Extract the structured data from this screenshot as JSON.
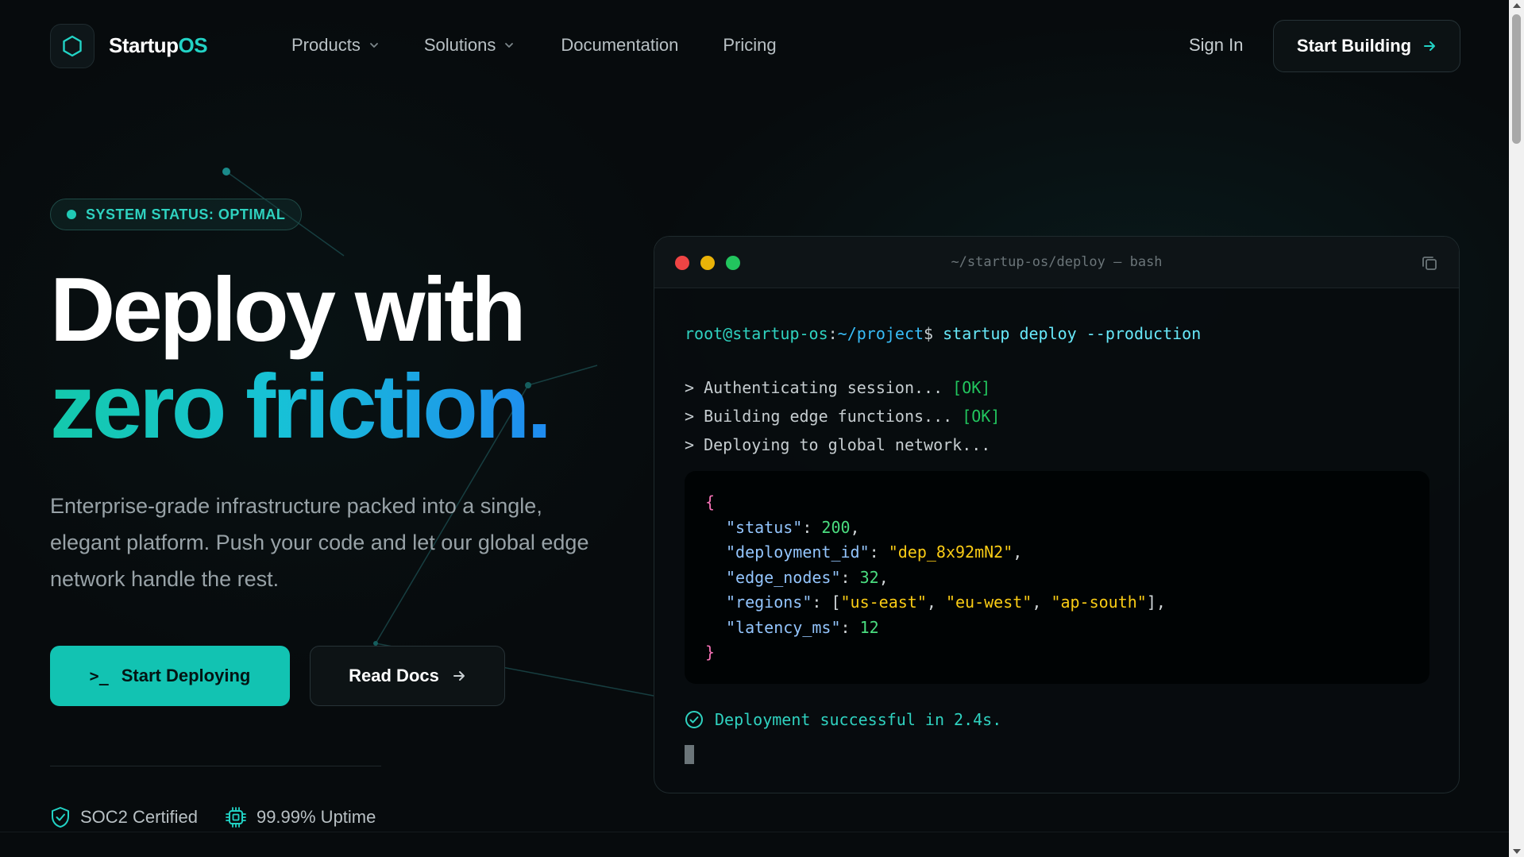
{
  "brand": {
    "name_prefix": "Startup",
    "name_suffix": "OS",
    "icon": "hexagon-icon"
  },
  "nav": {
    "items": [
      {
        "label": "Products",
        "has_dropdown": true
      },
      {
        "label": "Solutions",
        "has_dropdown": true
      },
      {
        "label": "Documentation",
        "has_dropdown": false
      },
      {
        "label": "Pricing",
        "has_dropdown": false
      }
    ],
    "sign_in": "Sign In",
    "cta": "Start Building"
  },
  "hero": {
    "status": "SYSTEM STATUS: OPTIMAL",
    "headline_line1": "Deploy with",
    "headline_line2": "zero friction.",
    "subtext": "Enterprise-grade infrastructure packed into a single, elegant platform. Push your code and let our global edge network handle the rest.",
    "primary_button": "Start Deploying",
    "primary_button_icon": ">_",
    "secondary_button": "Read Docs",
    "badges": [
      {
        "label": "SOC2 Certified",
        "icon": "shield-check-icon"
      },
      {
        "label": "99.99% Uptime",
        "icon": "cpu-chip-icon"
      }
    ]
  },
  "terminal": {
    "title": "~/startup-os/deploy — bash",
    "prompt_user": "root@startup-os",
    "prompt_sep": ":",
    "prompt_path": "~/project",
    "prompt_symbol": "$",
    "command": "startup deploy --production",
    "logs": [
      {
        "text": "> Authenticating session... ",
        "status": "[OK]"
      },
      {
        "text": "> Building edge functions... ",
        "status": "[OK]"
      },
      {
        "text": "> Deploying to global network...",
        "status": ""
      }
    ],
    "json": {
      "open": "{",
      "close": "}",
      "status_key": "\"status\"",
      "status_val": "200",
      "deployment_id_key": "\"deployment_id\"",
      "deployment_id_val": "\"dep_8x92mN2\"",
      "edge_nodes_key": "\"edge_nodes\"",
      "edge_nodes_val": "32",
      "regions_key": "\"regions\"",
      "regions": [
        "\"us-east\"",
        "\"eu-west\"",
        "\"ap-south\""
      ],
      "latency_key": "\"latency_ms\"",
      "latency_val": "12"
    },
    "success": "Deployment successful in 2.4s."
  },
  "colors": {
    "accent": "#12c3b2",
    "background": "#070b0d",
    "ok": "#22c55e",
    "string": "#facc15",
    "key": "#93c5fd",
    "brace": "#f472b6"
  }
}
